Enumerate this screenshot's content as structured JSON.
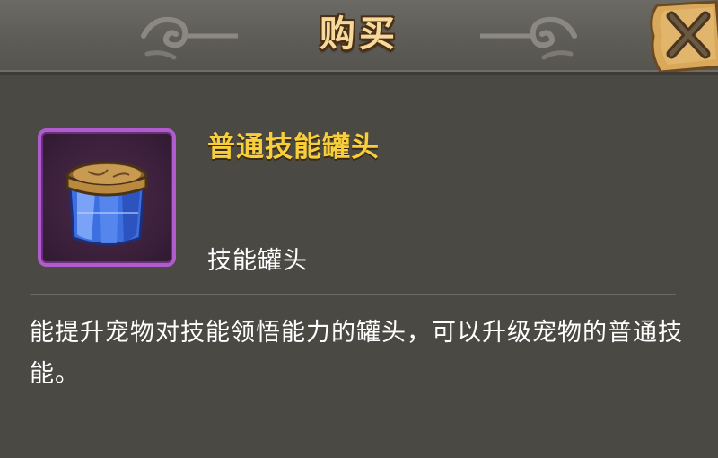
{
  "dialog": {
    "title": "购买",
    "close_icon": "close-x-icon"
  },
  "item": {
    "name": "普通技能罐头",
    "type": "技能罐头",
    "icon": "crystal-jar-icon",
    "frame_color": "#b05ccf",
    "name_color": "#f8cf3a"
  },
  "description": "能提升宠物对技能领悟能力的罐头，可以升级宠物的普通技能。",
  "colors": {
    "background": "#4b4943",
    "header": "#5e5c56",
    "title": "#f7d99a"
  }
}
